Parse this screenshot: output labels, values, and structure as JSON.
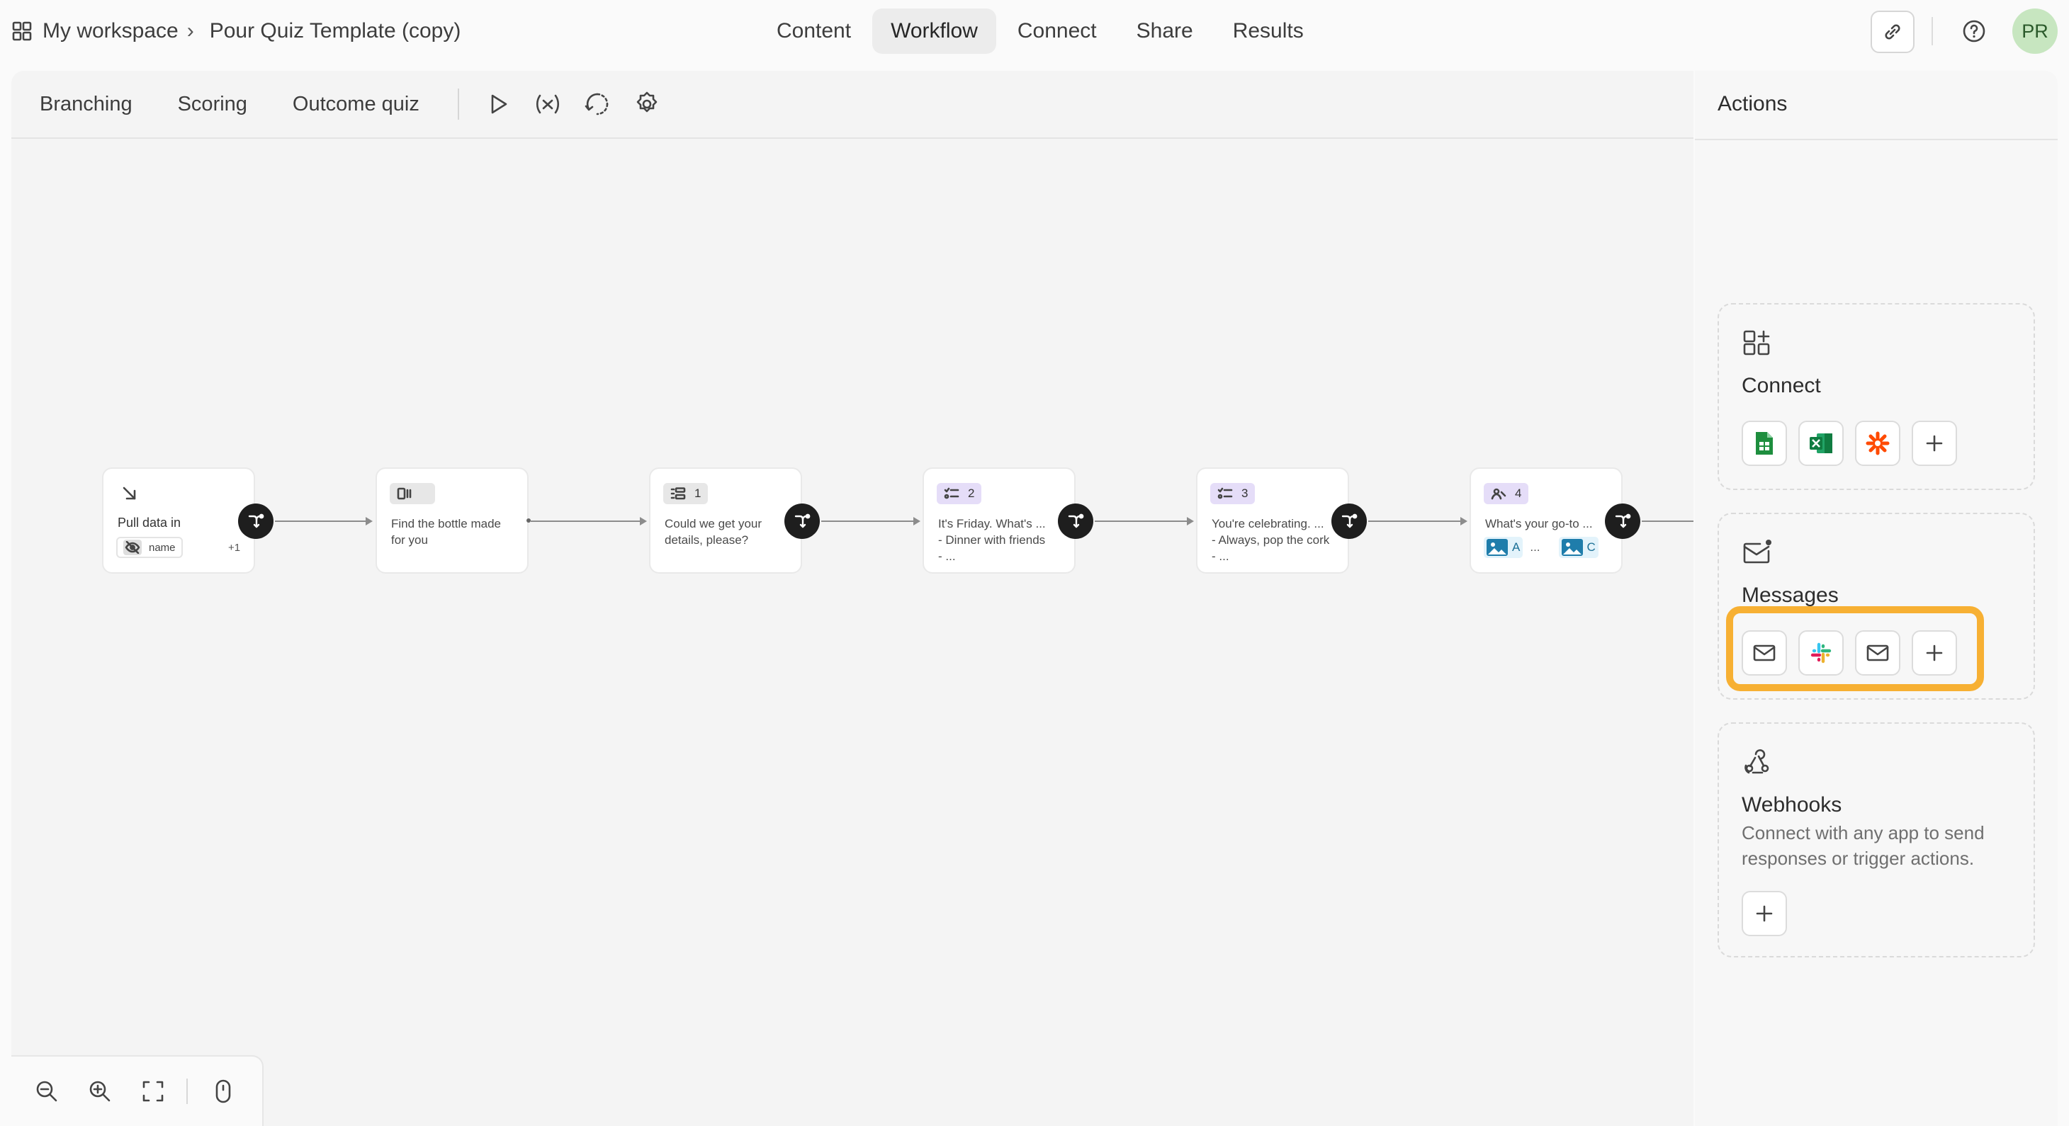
{
  "header": {
    "workspace": "My workspace",
    "form_title": "Pour Quiz Template (copy)",
    "tabs": [
      "Content",
      "Workflow",
      "Connect",
      "Share",
      "Results"
    ],
    "active_tab": "Workflow",
    "avatar_initials": "PR"
  },
  "toolbar": {
    "tabs": [
      "Branching",
      "Scoring",
      "Outcome quiz"
    ],
    "icons": [
      "play-icon",
      "variables-icon",
      "logic-map-icon",
      "settings-icon"
    ]
  },
  "flow": {
    "nodes": [
      {
        "kind": "data",
        "title": "Pull data in",
        "field": "name",
        "more": "+1"
      },
      {
        "kind": "statement",
        "text": "Find the bottle made\nfor you"
      },
      {
        "kind": "question",
        "number": "1",
        "text": "Could we get your\ndetails, please?"
      },
      {
        "kind": "question",
        "number": "2",
        "text": "It's Friday. What's ...\n- Dinner with friends\n- ..."
      },
      {
        "kind": "question",
        "number": "3",
        "text": "You're celebrating. ...\n- Always, pop the cork\n- ..."
      },
      {
        "kind": "question",
        "number": "4",
        "text": "What's your go-to ...",
        "choices": [
          "A",
          "...",
          "C"
        ]
      }
    ]
  },
  "zoom_controls": [
    "zoom-out-icon",
    "zoom-in-icon",
    "fit-screen-icon",
    "mouse-icon"
  ],
  "actions": {
    "title": "Actions",
    "connect": {
      "title": "Connect",
      "apps": [
        "google-sheets-icon",
        "excel-icon",
        "zapier-icon",
        "plus-icon"
      ]
    },
    "messages": {
      "title": "Messages",
      "apps": [
        "email-icon",
        "slack-icon",
        "email-icon",
        "plus-icon"
      ]
    },
    "webhooks": {
      "title": "Webhooks",
      "description": "Connect with any app to send responses or trigger actions."
    }
  },
  "colors": {
    "highlight": "#f7b033",
    "branch_button": "#1e1e1e",
    "question_badge": "#e5ddf8",
    "sheets": "#1e8e3e",
    "excel": "#107c41",
    "zapier": "#ff4a00"
  }
}
